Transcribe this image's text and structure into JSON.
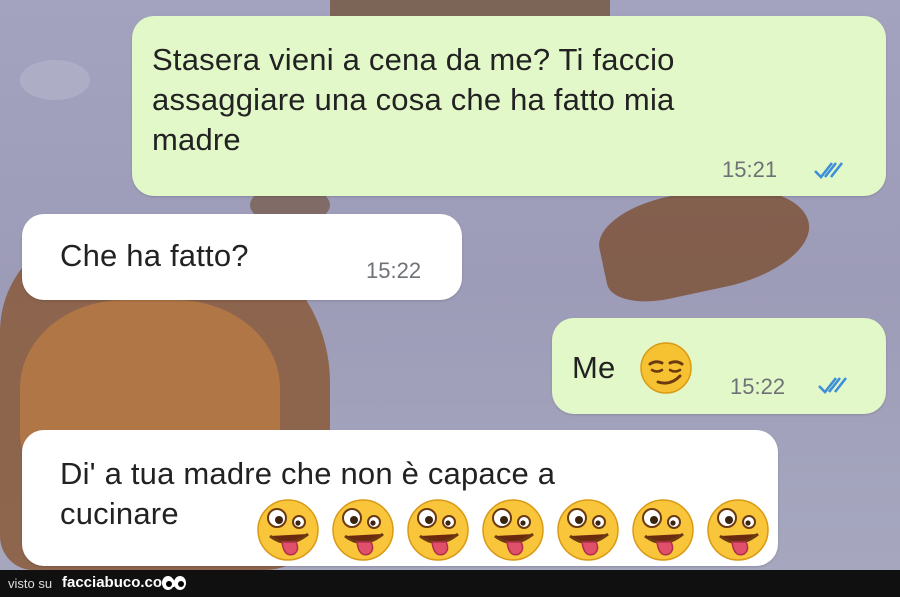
{
  "messages": [
    {
      "direction": "outgoing",
      "text_lines": [
        "Stasera vieni a cena da me? Ti faccio",
        "assaggiare una cosa che ha fatto mia",
        "madre"
      ],
      "time": "15:21",
      "status": "read"
    },
    {
      "direction": "incoming",
      "text": "Che ha fatto?",
      "time": "15:22"
    },
    {
      "direction": "outgoing",
      "text": "Me",
      "emoji": "smirking-face",
      "time": "15:22",
      "status": "read"
    },
    {
      "direction": "incoming",
      "text_lines": [
        "Di' a tua madre che non è capace a",
        "cucinare"
      ],
      "emoji": "zany-face",
      "emoji_count": 7,
      "time": ""
    }
  ],
  "footer": {
    "prefix": "visto su",
    "site": "facciabuco.com"
  },
  "colors": {
    "outgoing_bubble": "#e3f8c9",
    "incoming_bubble": "#ffffff",
    "read_ticks": "#3e8fd8",
    "background": "#a3a3bf"
  }
}
